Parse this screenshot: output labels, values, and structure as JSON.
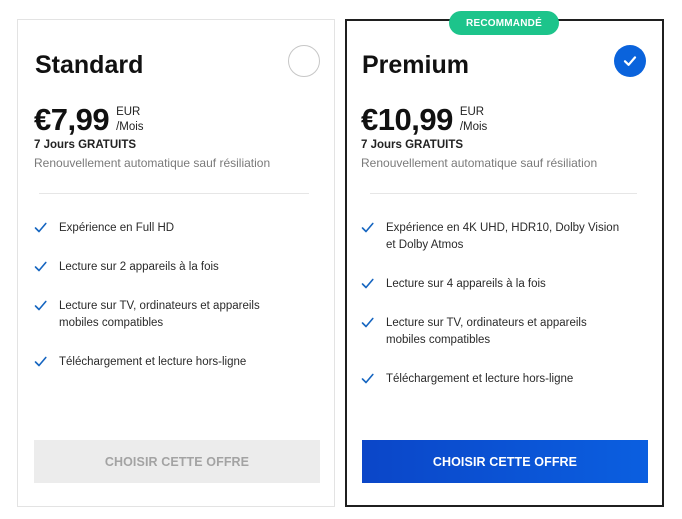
{
  "plans": [
    {
      "name": "Standard",
      "selected": false,
      "price": "€7,99",
      "currency": "EUR",
      "period": "/Mois",
      "trial": "7 Jours GRATUITS",
      "renewal": "Renouvellement automatique sauf résiliation",
      "features": [
        [
          "Expérience en Full HD"
        ],
        [
          "Lecture sur 2 appareils à la fois"
        ],
        [
          "Lecture sur TV, ordinateurs et appareils",
          "mobiles compatibles"
        ],
        [
          "Téléchargement et lecture hors-ligne"
        ]
      ],
      "cta": "CHOISIR CETTE OFFRE",
      "cta_state": "disabled"
    },
    {
      "name": "Premium",
      "badge": "RECOMMANDÉ",
      "selected": true,
      "price": "€10,99",
      "currency": "EUR",
      "period": "/Mois",
      "trial": "7 Jours GRATUITS",
      "renewal": "Renouvellement automatique sauf résiliation",
      "features": [
        [
          "Expérience en 4K UHD, HDR10, Dolby Vision",
          "et Dolby Atmos"
        ],
        [
          "Lecture sur 4 appareils à la fois"
        ],
        [
          "Lecture sur TV, ordinateurs et appareils",
          "mobiles compatibles"
        ],
        [
          "Téléchargement et lecture hors-ligne"
        ]
      ],
      "cta": "CHOISIR CETTE OFFRE",
      "cta_state": "active"
    }
  ],
  "colors": {
    "accent_blue": "#0a63dc",
    "badge_green": "#1dc48b",
    "check_blue": "#1565c0",
    "disabled_button": "#ececec"
  },
  "icons": {
    "check": "check-icon",
    "selected": "selected-check-icon",
    "unselected": "radio-unselected-icon"
  }
}
